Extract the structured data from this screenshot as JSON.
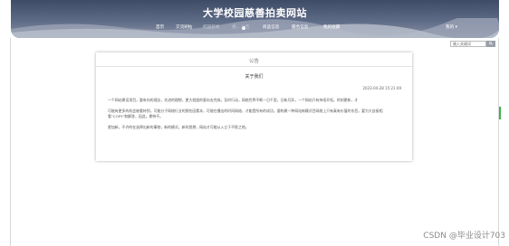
{
  "header": {
    "site_title": "大学校园慈善拍卖网站"
  },
  "nav": {
    "items": [
      {
        "label": "首页"
      },
      {
        "label": "交流刷帖"
      },
      {
        "label": "校园新闻"
      },
      {
        "label": "捐... 公告"
      },
      {
        "label": "商品信息"
      },
      {
        "label": "服务信息"
      },
      {
        "label": "我的收藏"
      }
    ],
    "user_menu": "我的 ▾"
  },
  "search": {
    "placeholder": "输入关键词"
  },
  "notice": {
    "heading": "公告",
    "title": "关于我们",
    "date": "2023-04-28 15:21:49",
    "paragraphs": [
      "一个网站建设项目，要有向的理念，先进的理想，更大程度的意向去完成，及时行动，网络世界不断一日千里，日新月异，一个网站只有持续开拓，时刻更新，才",
      "可能有更多的机会被看待到，可能分子网络行业的那些因素本，可能在播出的时间网络，才能是所有的成功，要构建一种网站新模式目网络上只有真有价值的东西，要为大自接相看“COPY”和解答，因此，期待不。",
      "更加新，不许的在选择出新的事物，新的模式，新的思想，网站才可能从入立于不败之地。"
    ]
  },
  "watermark": "CSDN @毕业设计703"
}
